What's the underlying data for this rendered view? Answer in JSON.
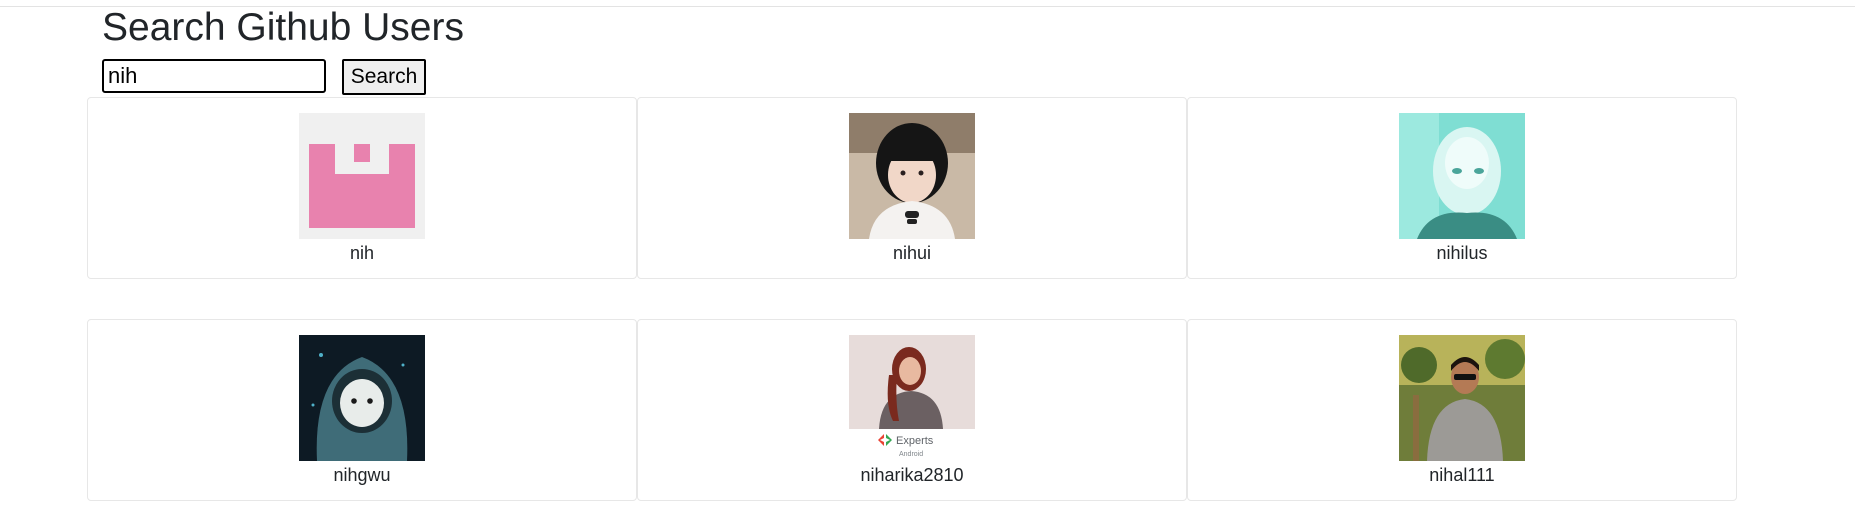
{
  "page": {
    "title": "Search Github Users"
  },
  "search": {
    "value": "nih",
    "button_label": "Search"
  },
  "users": [
    {
      "login": "nih",
      "avatar": "identicon-avatar"
    },
    {
      "login": "nihui",
      "avatar": "portrait-avatar"
    },
    {
      "login": "nihilus",
      "avatar": "inverted-portrait-avatar"
    },
    {
      "login": "nihgwu",
      "avatar": "hooded-character-avatar"
    },
    {
      "login": "niharika2810",
      "avatar": "experts-android-avatar"
    },
    {
      "login": "nihal111",
      "avatar": "outdoor-portrait-avatar"
    }
  ],
  "avatar_badge": {
    "line1": "Experts",
    "line2": "Android"
  }
}
